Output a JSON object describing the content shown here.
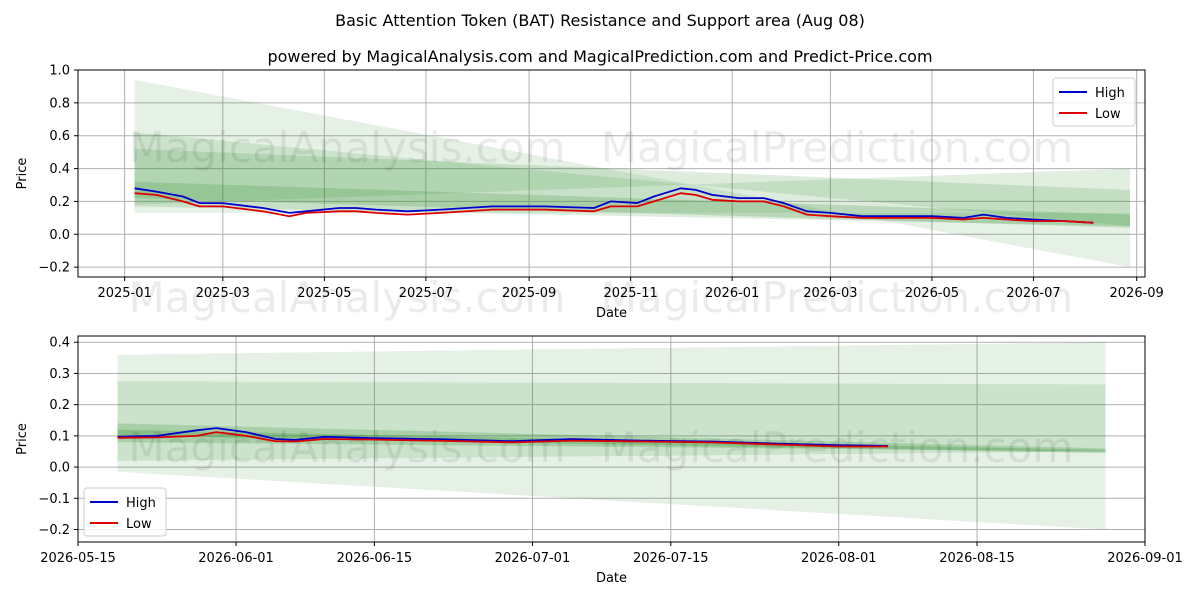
{
  "title": "Basic Attention Token (BAT) Resistance and Support area (Aug 08)",
  "subtitle": "powered by MagicalAnalysis.com and MagicalPrediction.com and Predict-Price.com",
  "watermarks": [
    "MagicalAnalysis.com",
    "MagicalPrediction.com"
  ],
  "colors": {
    "high": "#0000cc",
    "low": "#dd0000",
    "band": "#2e8b2e"
  },
  "chart_data": [
    {
      "type": "line",
      "xlabel": "Date",
      "ylabel": "Price",
      "xlim": [
        "2024-12-04",
        "2026-09-06"
      ],
      "ylim": [
        -0.26,
        1.0
      ],
      "grid": true,
      "legend": "top-right",
      "x_ticks": [
        "2025-01",
        "2025-03",
        "2025-05",
        "2025-07",
        "2025-09",
        "2025-11",
        "2026-01",
        "2026-03",
        "2026-05",
        "2026-07",
        "2026-09"
      ],
      "x_tick_dates": [
        "2025-01-01",
        "2025-03-01",
        "2025-05-01",
        "2025-07-01",
        "2025-09-01",
        "2025-11-01",
        "2026-01-01",
        "2026-03-01",
        "2026-05-01",
        "2026-07-01",
        "2026-09-01"
      ],
      "y_ticks": [
        "1.0",
        "0.8",
        "0.6",
        "0.4",
        "0.2",
        "0.0",
        "−0.2"
      ],
      "y_tick_values": [
        1.0,
        0.8,
        0.6,
        0.4,
        0.2,
        0.0,
        -0.2
      ],
      "bands": [
        {
          "x": [
            "2025-01-07",
            "2026-08-28"
          ],
          "upper": [
            0.94,
            -0.2
          ],
          "lower": [
            0.13,
            0.13
          ],
          "opacity": 0.12
        },
        {
          "x": [
            "2025-01-07",
            "2026-08-28"
          ],
          "upper": [
            0.62,
            0.05
          ],
          "lower": [
            0.18,
            0.4
          ],
          "opacity": 0.14
        },
        {
          "x": [
            "2025-01-07",
            "2026-08-28"
          ],
          "upper": [
            0.52,
            0.27
          ],
          "lower": [
            0.17,
            0.05
          ],
          "opacity": 0.16
        },
        {
          "x": [
            "2025-01-07",
            "2026-08-28"
          ],
          "upper": [
            0.32,
            0.12
          ],
          "lower": [
            0.22,
            0.04
          ],
          "opacity": 0.2
        }
      ],
      "series": [
        {
          "name": "High",
          "x": [
            "2025-01-07",
            "2025-01-20",
            "2025-02-05",
            "2025-02-15",
            "2025-03-01",
            "2025-03-25",
            "2025-04-10",
            "2025-04-20",
            "2025-05-10",
            "2025-05-20",
            "2025-06-01",
            "2025-06-20",
            "2025-07-10",
            "2025-08-10",
            "2025-09-10",
            "2025-10-10",
            "2025-10-20",
            "2025-11-05",
            "2025-11-15",
            "2025-12-01",
            "2025-12-10",
            "2025-12-20",
            "2026-01-05",
            "2026-01-20",
            "2026-02-01",
            "2026-02-15",
            "2026-03-01",
            "2026-03-20",
            "2026-04-10",
            "2026-05-01",
            "2026-05-20",
            "2026-06-01",
            "2026-06-15",
            "2026-07-01",
            "2026-07-20",
            "2026-08-06"
          ],
          "y": [
            0.28,
            0.26,
            0.23,
            0.19,
            0.19,
            0.16,
            0.13,
            0.14,
            0.16,
            0.16,
            0.15,
            0.14,
            0.15,
            0.17,
            0.17,
            0.16,
            0.2,
            0.19,
            0.23,
            0.28,
            0.27,
            0.24,
            0.22,
            0.22,
            0.19,
            0.14,
            0.13,
            0.11,
            0.11,
            0.11,
            0.1,
            0.12,
            0.1,
            0.09,
            0.08,
            0.07
          ]
        },
        {
          "name": "Low",
          "x": [
            "2025-01-07",
            "2025-01-20",
            "2025-02-05",
            "2025-02-15",
            "2025-03-01",
            "2025-03-25",
            "2025-04-10",
            "2025-04-20",
            "2025-05-10",
            "2025-05-20",
            "2025-06-01",
            "2025-06-20",
            "2025-07-10",
            "2025-08-10",
            "2025-09-10",
            "2025-10-10",
            "2025-10-20",
            "2025-11-05",
            "2025-11-15",
            "2025-12-01",
            "2025-12-10",
            "2025-12-20",
            "2026-01-05",
            "2026-01-20",
            "2026-02-01",
            "2026-02-15",
            "2026-03-01",
            "2026-03-20",
            "2026-04-10",
            "2026-05-01",
            "2026-05-20",
            "2026-06-01",
            "2026-06-15",
            "2026-07-01",
            "2026-07-20",
            "2026-08-06"
          ],
          "y": [
            0.25,
            0.24,
            0.2,
            0.17,
            0.17,
            0.14,
            0.11,
            0.13,
            0.14,
            0.14,
            0.13,
            0.12,
            0.13,
            0.15,
            0.15,
            0.14,
            0.17,
            0.17,
            0.2,
            0.25,
            0.24,
            0.21,
            0.2,
            0.2,
            0.17,
            0.12,
            0.11,
            0.1,
            0.1,
            0.1,
            0.09,
            0.1,
            0.09,
            0.08,
            0.08,
            0.07
          ]
        }
      ]
    },
    {
      "type": "line",
      "xlabel": "Date",
      "ylabel": "Price",
      "xlim": [
        "2026-05-16",
        "2026-09-01"
      ],
      "ylim": [
        -0.24,
        0.42
      ],
      "grid": true,
      "legend": "bottom-left",
      "x_ticks": [
        "2026-05-15",
        "2026-06-01",
        "2026-06-15",
        "2026-07-01",
        "2026-07-15",
        "2026-08-01",
        "2026-08-15",
        "2026-09-01"
      ],
      "x_tick_dates": [
        "2026-05-16",
        "2026-06-01",
        "2026-06-15",
        "2026-07-01",
        "2026-07-15",
        "2026-08-01",
        "2026-08-15",
        "2026-09-01"
      ],
      "y_ticks": [
        "0.4",
        "0.3",
        "0.2",
        "0.1",
        "0.0",
        "−0.1",
        "−0.2"
      ],
      "y_tick_values": [
        0.4,
        0.3,
        0.2,
        0.1,
        0.0,
        -0.1,
        -0.2
      ],
      "bands": [
        {
          "x": [
            "2026-05-20",
            "2026-08-28"
          ],
          "upper": [
            0.36,
            0.4
          ],
          "lower": [
            -0.015,
            -0.2
          ],
          "opacity": 0.12
        },
        {
          "x": [
            "2026-05-20",
            "2026-08-28"
          ],
          "upper": [
            0.275,
            0.265
          ],
          "lower": [
            0.02,
            0.05
          ],
          "opacity": 0.14
        },
        {
          "x": [
            "2026-05-20",
            "2026-08-28"
          ],
          "upper": [
            0.14,
            0.06
          ],
          "lower": [
            0.08,
            0.05
          ],
          "opacity": 0.22
        },
        {
          "x": [
            "2026-05-20",
            "2026-08-28"
          ],
          "upper": [
            0.12,
            0.055
          ],
          "lower": [
            0.1,
            0.045
          ],
          "opacity": 0.26
        }
      ],
      "series": [
        {
          "name": "High",
          "x": [
            "2026-05-20",
            "2026-05-24",
            "2026-05-28",
            "2026-05-30",
            "2026-06-02",
            "2026-06-05",
            "2026-06-07",
            "2026-06-10",
            "2026-06-15",
            "2026-06-22",
            "2026-06-29",
            "2026-07-05",
            "2026-07-12",
            "2026-07-19",
            "2026-07-26",
            "2026-08-01",
            "2026-08-06"
          ],
          "y": [
            0.097,
            0.1,
            0.118,
            0.125,
            0.112,
            0.09,
            0.087,
            0.097,
            0.093,
            0.089,
            0.083,
            0.09,
            0.085,
            0.082,
            0.075,
            0.07,
            0.068
          ]
        },
        {
          "name": "Low",
          "x": [
            "2026-05-20",
            "2026-05-24",
            "2026-05-28",
            "2026-05-30",
            "2026-06-02",
            "2026-06-05",
            "2026-06-07",
            "2026-06-10",
            "2026-06-15",
            "2026-06-22",
            "2026-06-29",
            "2026-07-05",
            "2026-07-12",
            "2026-07-19",
            "2026-07-26",
            "2026-08-01",
            "2026-08-06"
          ],
          "y": [
            0.094,
            0.095,
            0.1,
            0.112,
            0.1,
            0.083,
            0.082,
            0.09,
            0.088,
            0.084,
            0.079,
            0.085,
            0.082,
            0.079,
            0.072,
            0.066,
            0.066
          ]
        }
      ]
    }
  ]
}
